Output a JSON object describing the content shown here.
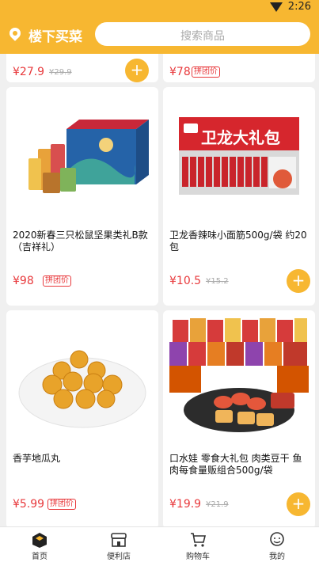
{
  "status": {
    "time": "2:26"
  },
  "header": {
    "store_name": "楼下买菜",
    "search_placeholder": "搜索商品"
  },
  "partial_cards": [
    {
      "price": "¥27.9",
      "orig": "¥29.9"
    },
    {
      "price": "¥78",
      "badge": "拼团价"
    }
  ],
  "products": [
    {
      "title": "2020新春三只松鼠坚果类礼B款（吉祥礼）",
      "price": "¥98",
      "badge": "拼团价"
    },
    {
      "title": "卫龙香辣味小面筋500g/袋 约20包",
      "price": "¥10.5",
      "orig": "¥15.2",
      "brand_text": "卫龙大礼包",
      "add": "+"
    },
    {
      "title": "香芋地瓜丸",
      "price": "¥5.99",
      "badge": "拼团价"
    },
    {
      "title": "口水娃 零食大礼包 肉类豆干 鱼肉每食量贩组合500g/袋",
      "price": "¥19.9",
      "orig": "¥21.9",
      "add": "+"
    }
  ],
  "tabs": [
    {
      "label": "首页",
      "icon": "home-icon"
    },
    {
      "label": "便利店",
      "icon": "store-icon"
    },
    {
      "label": "购物车",
      "icon": "cart-icon"
    },
    {
      "label": "我的",
      "icon": "profile-icon"
    }
  ],
  "colors": {
    "accent": "#f7b731",
    "price": "#e8393c"
  }
}
